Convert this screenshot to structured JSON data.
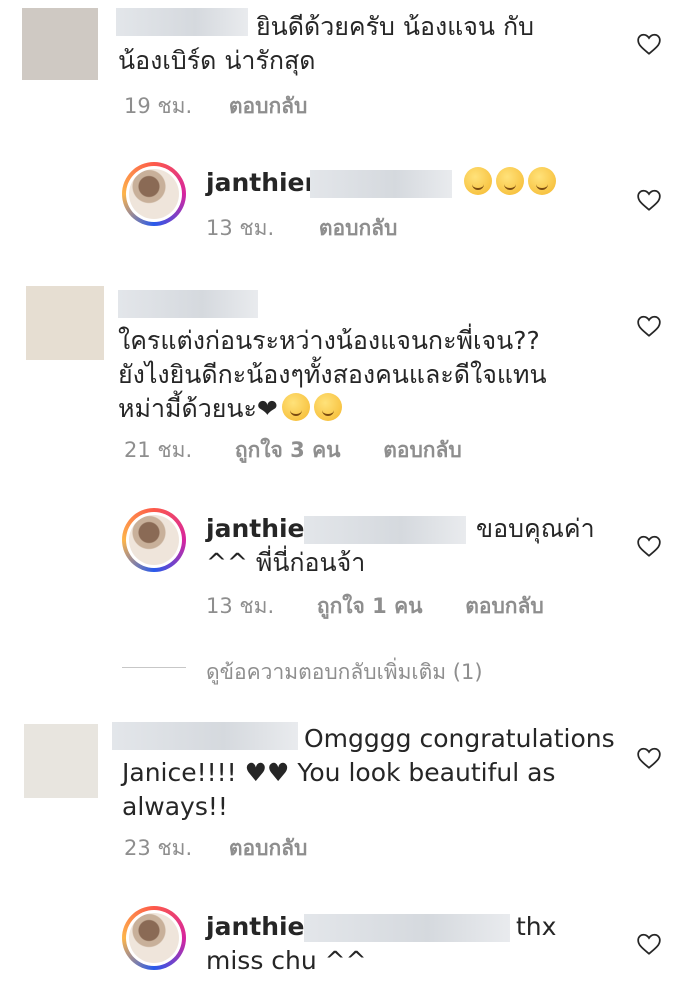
{
  "comments": [
    {
      "text_line1": "ยินดีด้วยครับ น้องแจน กับ",
      "text_line2": "น้องเบิร์ด น่ารักสุด",
      "time": "19 ชม.",
      "reply": "ตอบกลับ"
    },
    {
      "username": "janthien",
      "time": "13 ชม.",
      "reply": "ตอบกลับ"
    },
    {
      "text_line1": "ใครแต่งก่อนระหว่างน้องแจนกะพี่เจน??",
      "text_line2": "ยังไงยินดีกะน้องๆทั้งสองคนและดีใจแทน",
      "text_line3": "หม่ามี้ด้วยนะ❤",
      "time": "21 ชม.",
      "likes": "ถูกใจ 3 คน",
      "reply": "ตอบกลับ"
    },
    {
      "username": "janthien",
      "text_tail": "ขอบคุณค่า",
      "text_line2": "^^ พี่นี่ก่อนจ้า",
      "time": "13 ชม.",
      "likes": "ถูกใจ 1 คน",
      "reply": "ตอบกลับ"
    },
    {
      "text_tail": "Omgggg congratulations",
      "text_line2": "Janice!!!! ♥♥ You look beautiful as",
      "text_line3": "always!!",
      "time": "23 ชม.",
      "reply": "ตอบกลับ"
    },
    {
      "username": "janthien",
      "text_tail": "thx",
      "text_line2": "miss chu ^^",
      "time": "",
      "reply": ""
    }
  ],
  "view_more_replies": "ดูข้อความตอบกลับเพิ่มเติม (1)",
  "icons": {
    "like": "heart-outline-icon",
    "emoji": "smiley-emoji-icon"
  },
  "colors": {
    "meta": "#8e8e8e",
    "text": "#262626"
  }
}
